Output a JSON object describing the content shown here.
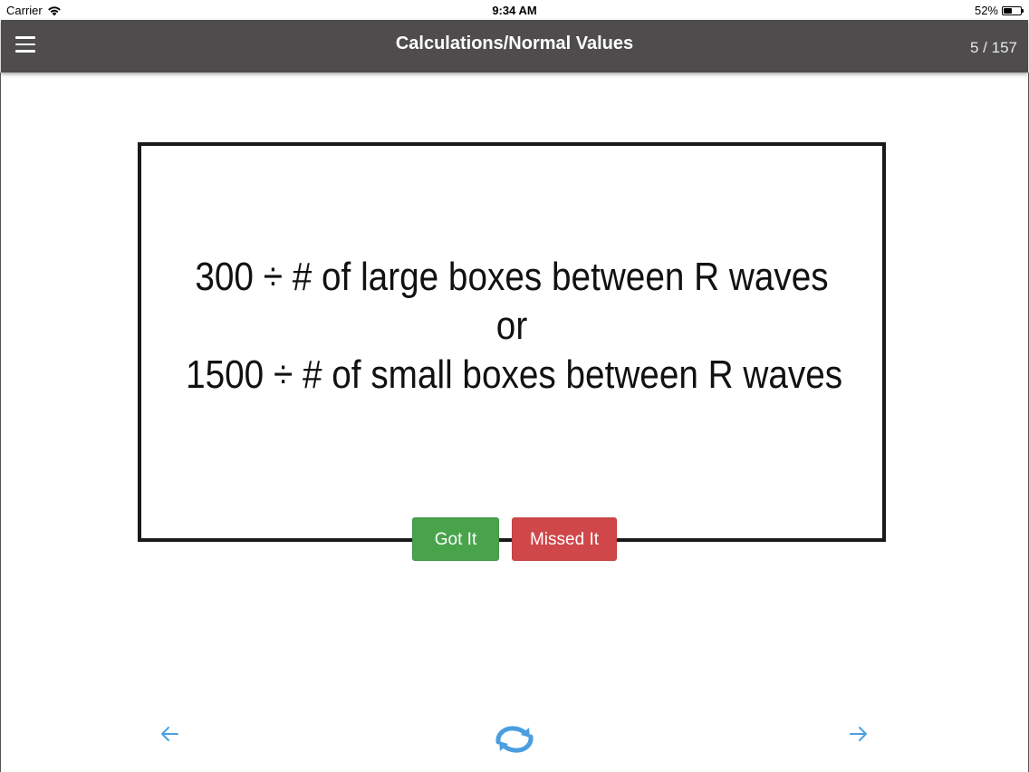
{
  "status_bar": {
    "carrier": "Carrier",
    "time": "9:34 AM",
    "battery_percent": "52%",
    "battery_level": 0.52
  },
  "nav": {
    "title": "Calculations/Normal Values",
    "counter": "5 / 157"
  },
  "card": {
    "line1": "300 ÷ # of large boxes between R waves",
    "line2": "or",
    "line3": "1500 ÷ # of small boxes between R waves"
  },
  "buttons": {
    "got_it": "Got It",
    "missed_it": "Missed It"
  },
  "colors": {
    "nav_background": "#4e4c4d",
    "got_it": "#48a34b",
    "missed_it": "#d0474a",
    "footer_icons": "#4a9fe0"
  },
  "icons": {
    "menu": "hamburger-menu-icon",
    "previous": "arrow-left-icon",
    "flip": "refresh-icon",
    "next": "arrow-right-icon"
  }
}
